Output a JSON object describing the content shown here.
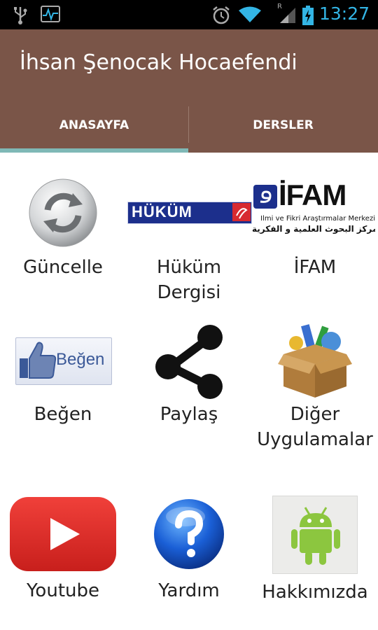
{
  "statusbar": {
    "time": "13:27",
    "roaming_indicator": "R",
    "icons": [
      "usb-icon",
      "activity-icon",
      "alarm-icon",
      "wifi-icon",
      "signal-icon",
      "battery-icon"
    ]
  },
  "app": {
    "title": "İhsan Şenocak Hocaefendi"
  },
  "tabs": [
    {
      "label": "ANASAYFA",
      "selected": true
    },
    {
      "label": "DERSLER",
      "selected": false
    }
  ],
  "logos": {
    "hukum": "HÜKÜM",
    "ifam": "İFAM",
    "ifam_sub": "İlmi ve Fikri Araştırmalar Merkezi",
    "ifam_arabic": "مركز البحوث العلمية و الفكرية",
    "begen_badge": "Beğen"
  },
  "grid": [
    {
      "label_line1": "Güncelle",
      "label_line2": "",
      "icon": "refresh-icon"
    },
    {
      "label_line1": "Hüküm",
      "label_line2": "Dergisi",
      "icon": "hukum-logo"
    },
    {
      "label_line1": "İFAM",
      "label_line2": "",
      "icon": "ifam-logo"
    },
    {
      "label_line1": "Beğen",
      "label_line2": "",
      "icon": "like-icon"
    },
    {
      "label_line1": "Paylaş",
      "label_line2": "",
      "icon": "share-icon"
    },
    {
      "label_line1": "Diğer",
      "label_line2": "Uygulamalar",
      "icon": "box-icon"
    },
    {
      "label_line1": "Youtube",
      "label_line2": "",
      "icon": "youtube-icon"
    },
    {
      "label_line1": "Yardım",
      "label_line2": "",
      "icon": "help-icon"
    },
    {
      "label_line1": "Hakkımızda",
      "label_line2": "",
      "icon": "android-icon"
    }
  ],
  "colors": {
    "action_bar": "#7a5548",
    "tab_indicator": "#7fb8b6",
    "status_accent": "#33b5e5",
    "hukum_blue": "#1c2f8c",
    "youtube_red": "#e02a27"
  }
}
